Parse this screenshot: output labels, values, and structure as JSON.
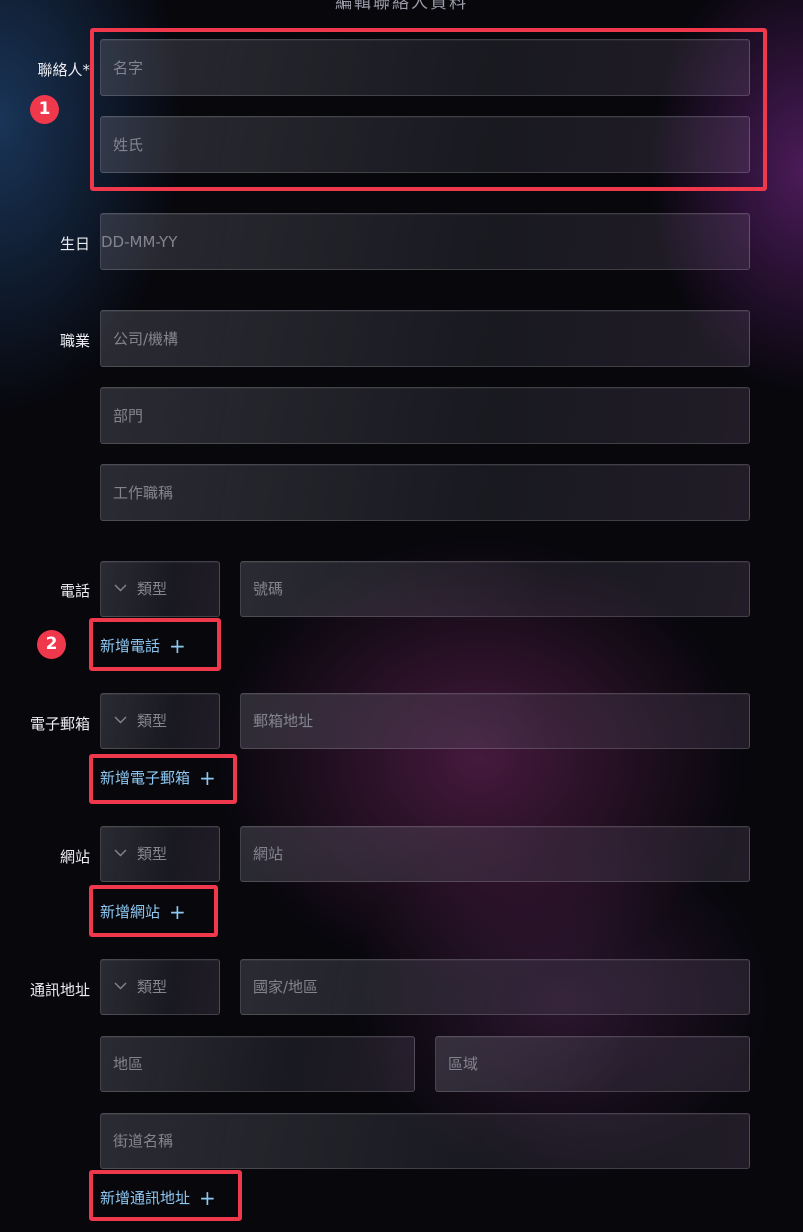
{
  "header": {
    "partial_title": "編輯聯絡人資料"
  },
  "form": {
    "contact": {
      "label": "聯絡人*",
      "first_name_placeholder": "名字",
      "last_name_placeholder": "姓氏"
    },
    "birthday": {
      "label": "生日",
      "placeholder": "DD-MM-YY"
    },
    "job": {
      "label": "職業",
      "company_placeholder": "公司/機構",
      "department_placeholder": "部門",
      "title_placeholder": "工作職稱"
    },
    "phone": {
      "label": "電話",
      "type_select": "類型",
      "number_placeholder": "號碼",
      "add_label": "新增電話"
    },
    "email": {
      "label": "電子郵箱",
      "type_select": "類型",
      "address_placeholder": "郵箱地址",
      "add_label": "新增電子郵箱"
    },
    "website": {
      "label": "網站",
      "type_select": "類型",
      "url_placeholder": "網站",
      "add_label": "新增網站"
    },
    "address": {
      "label": "通訊地址",
      "type_select": "類型",
      "country_placeholder": "國家/地區",
      "region_placeholder": "地區",
      "district_placeholder": "區域",
      "street_placeholder": "街道名稱",
      "add_label": "新增通訊地址"
    },
    "add_icon": "+"
  },
  "annotations": {
    "badge_1": "1",
    "badge_2": "2",
    "highlight_color": "#f0384d"
  },
  "colors": {
    "link": "#8ec8f2",
    "placeholder": "#84848f"
  }
}
